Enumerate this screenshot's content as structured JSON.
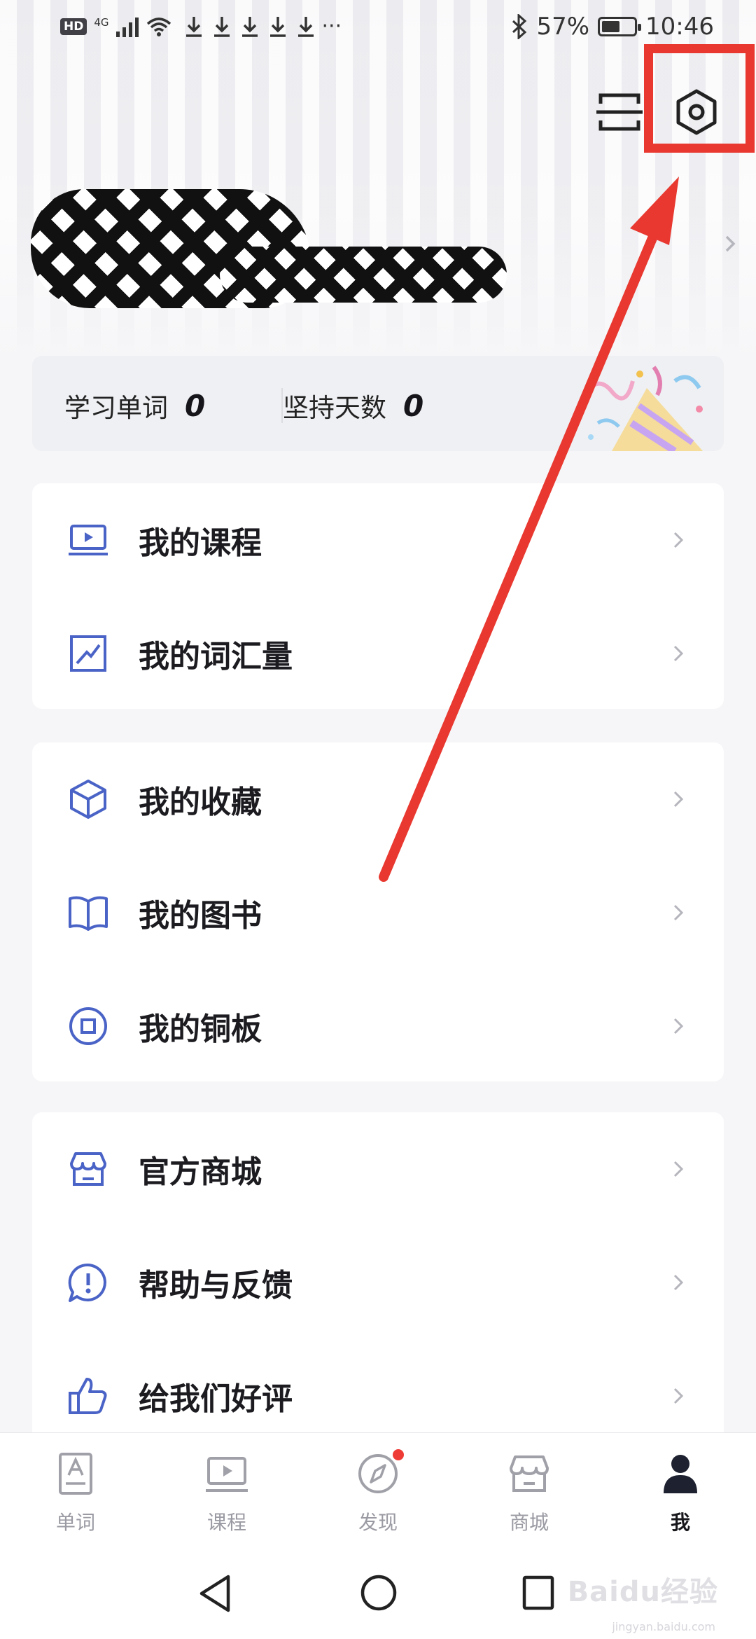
{
  "status_bar": {
    "hd": "HD",
    "network": "4G",
    "more": "···",
    "battery_percent": "57%",
    "battery_level": 0.57,
    "time": "10:46"
  },
  "header": {
    "scan_icon": "scan-icon",
    "settings_icon": "settings-hexagon-icon"
  },
  "stats": {
    "words_label": "学习单词",
    "words_value": "0",
    "days_label": "坚持天数",
    "days_value": "0"
  },
  "menu_groups": [
    {
      "items": [
        {
          "label": "我的课程",
          "icon": "course-play-icon"
        },
        {
          "label": "我的词汇量",
          "icon": "vocabulary-chart-icon"
        }
      ]
    },
    {
      "items": [
        {
          "label": "我的收藏",
          "icon": "favorites-cube-icon"
        },
        {
          "label": "我的图书",
          "icon": "book-icon"
        },
        {
          "label": "我的铜板",
          "icon": "coin-icon"
        }
      ]
    },
    {
      "items": [
        {
          "label": "官方商城",
          "icon": "store-icon"
        },
        {
          "label": "帮助与反馈",
          "icon": "help-feedback-icon"
        },
        {
          "label": "给我们好评",
          "icon": "thumbs-up-icon"
        }
      ]
    }
  ],
  "tabs": [
    {
      "label": "单词",
      "icon": "word-card-icon",
      "active": false
    },
    {
      "label": "课程",
      "icon": "course-icon",
      "active": false
    },
    {
      "label": "发现",
      "icon": "compass-icon",
      "active": false,
      "badge": true
    },
    {
      "label": "商城",
      "icon": "store-icon",
      "active": false
    },
    {
      "label": "我",
      "icon": "person-icon",
      "active": true
    }
  ],
  "watermark": {
    "text": "Baidu经验",
    "sub": "jingyan.baidu.com"
  },
  "colors": {
    "icon_blue": "#4a63c6",
    "annotation_red": "#e8382f",
    "badge_red": "#ef3b35"
  }
}
